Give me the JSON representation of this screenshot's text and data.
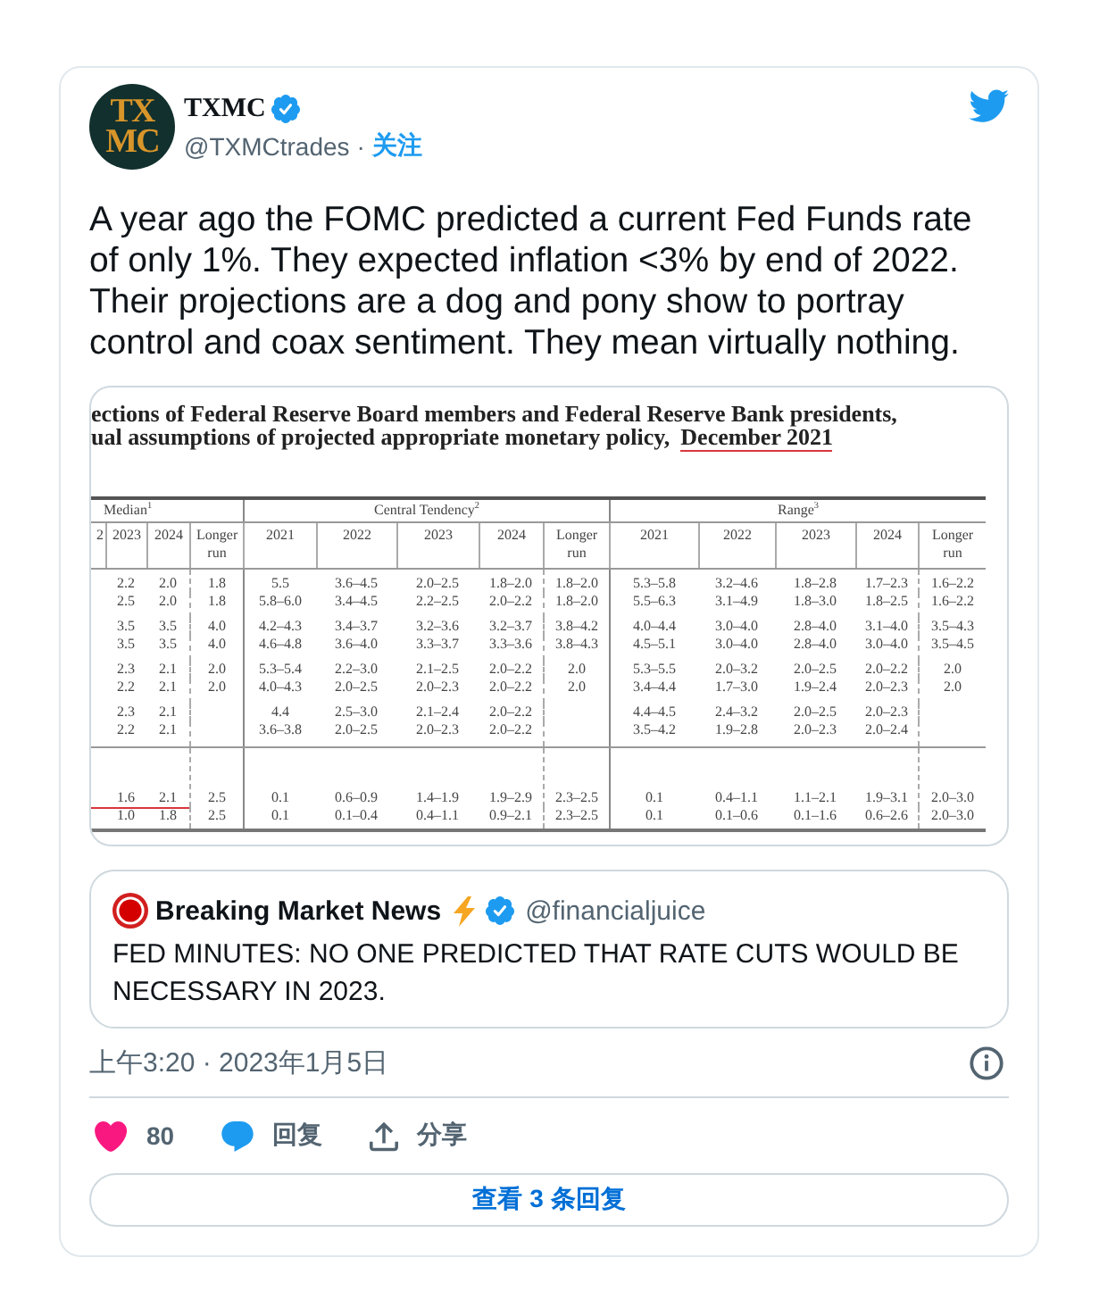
{
  "tweet": {
    "author": {
      "avatar_text": [
        "TX",
        "MC"
      ],
      "name": "TXMC",
      "verified": true,
      "handle": "@TXMCtrades",
      "separator": "·",
      "follow": "关注"
    },
    "text": "A year ago the FOMC predicted a current Fed Funds rate of only 1%. They expected inflation <3% by end of 2022. Their projections are a dog and pony show to portray control and coax sentiment. They mean virtually nothing.",
    "media": {
      "heading": [
        [
          {
            "text": "ections of Federal Reserve Board members and Federal Reserve Bank presidents,",
            "underlined": false
          }
        ],
        [
          {
            "text": "ual assumptions of projected appropriate monetary policy,",
            "underlined": false
          },
          {
            "text": "December 2021",
            "underlined": true
          }
        ]
      ],
      "table": {
        "groups": [
          {
            "label": "Median$^{1}$",
            "columns": [
              "2",
              "2023",
              "2024",
              "Longer run"
            ]
          },
          {
            "label": "Central Tendency$^{2}$",
            "columns": [
              "2021",
              "2022",
              "2023",
              "2024",
              "Longer run"
            ]
          },
          {
            "label": "Range$^{3}$",
            "columns": [
              "2021",
              "2022",
              "2023",
              "2024",
              "Longer run"
            ]
          }
        ],
        "sections": [
          {
            "row_groups": [
              {
                "rows": [
                  {
                    "cells": [
                      null,
                      "2.2",
                      "2.0",
                      "1.8",
                      "5.5",
                      "3.6–4.5",
                      "2.0–2.5",
                      "1.8–2.0",
                      "1.8–2.0",
                      "5.3–5.8",
                      "3.2–4.6",
                      "1.8–2.8",
                      "1.7–2.3",
                      "1.6–2.2"
                    ],
                    "underlined": false
                  },
                  {
                    "cells": [
                      null,
                      "2.5",
                      "2.0",
                      "1.8",
                      "5.8–6.0",
                      "3.4–4.5",
                      "2.2–2.5",
                      "2.0–2.2",
                      "1.8–2.0",
                      "5.5–6.3",
                      "3.1–4.9",
                      "1.8–3.0",
                      "1.8–2.5",
                      "1.6–2.2"
                    ],
                    "underlined": false
                  }
                ]
              },
              {
                "rows": [
                  {
                    "cells": [
                      null,
                      "3.5",
                      "3.5",
                      "4.0",
                      "4.2–4.3",
                      "3.4–3.7",
                      "3.2–3.6",
                      "3.2–3.7",
                      "3.8–4.2",
                      "4.0–4.4",
                      "3.0–4.0",
                      "2.8–4.0",
                      "3.1–4.0",
                      "3.5–4.3"
                    ],
                    "underlined": false
                  },
                  {
                    "cells": [
                      null,
                      "3.5",
                      "3.5",
                      "4.0",
                      "4.6–4.8",
                      "3.6–4.0",
                      "3.3–3.7",
                      "3.3–3.6",
                      "3.8–4.3",
                      "4.5–5.1",
                      "3.0–4.0",
                      "2.8–4.0",
                      "3.0–4.0",
                      "3.5–4.5"
                    ],
                    "underlined": false
                  }
                ]
              },
              {
                "rows": [
                  {
                    "cells": [
                      null,
                      "2.3",
                      "2.1",
                      "2.0",
                      "5.3–5.4",
                      "2.2–3.0",
                      "2.1–2.5",
                      "2.0–2.2",
                      "2.0",
                      "5.3–5.5",
                      "2.0–3.2",
                      "2.0–2.5",
                      "2.0–2.2",
                      "2.0"
                    ],
                    "underlined": false
                  },
                  {
                    "cells": [
                      null,
                      "2.2",
                      "2.1",
                      "2.0",
                      "4.0–4.3",
                      "2.0–2.5",
                      "2.0–2.3",
                      "2.0–2.2",
                      "2.0",
                      "3.4–4.4",
                      "1.7–3.0",
                      "1.9–2.4",
                      "2.0–2.3",
                      "2.0"
                    ],
                    "underlined": false
                  }
                ]
              },
              {
                "rows": [
                  {
                    "cells": [
                      null,
                      "2.3",
                      "2.1",
                      null,
                      "4.4",
                      "2.5–3.0",
                      "2.1–2.4",
                      "2.0–2.2",
                      null,
                      "4.4–4.5",
                      "2.4–3.2",
                      "2.0–2.5",
                      "2.0–2.3",
                      null
                    ],
                    "underlined": false
                  },
                  {
                    "cells": [
                      null,
                      "2.2",
                      "2.1",
                      null,
                      "3.6–3.8",
                      "2.0–2.5",
                      "2.0–2.3",
                      "2.0–2.2",
                      null,
                      "3.5–4.2",
                      "1.9–2.8",
                      "2.0–2.3",
                      "2.0–2.4",
                      null
                    ],
                    "underlined": false
                  }
                ]
              }
            ]
          },
          {
            "row_groups": [
              {
                "rows": [
                  {
                    "cells": [
                      null,
                      "1.6",
                      "2.1",
                      "2.5",
                      "0.1",
                      "0.6–0.9",
                      "1.4–1.9",
                      "1.9–2.9",
                      "2.3–2.5",
                      "0.1",
                      "0.4–1.1",
                      "1.1–2.1",
                      "1.9–3.1",
                      "2.0–3.0"
                    ],
                    "underlined": true
                  },
                  {
                    "cells": [
                      null,
                      "1.0",
                      "1.8",
                      "2.5",
                      "0.1",
                      "0.1–0.4",
                      "0.4–1.1",
                      "0.9–2.1",
                      "2.3–2.5",
                      "0.1",
                      "0.1–0.6",
                      "0.1–1.6",
                      "0.6–2.6",
                      "2.0–3.0"
                    ],
                    "underlined": false
                  }
                ]
              }
            ]
          }
        ]
      }
    },
    "quoted": {
      "name": "Breaking Market News",
      "verified": true,
      "handle": "@financialjuice",
      "text": "FED MINUTES: NO ONE PREDICTED THAT RATE CUTS WOULD BE NECESSARY IN 2023."
    },
    "timestamp": "上午3:20 · 2023年1月5日",
    "actions": [
      {
        "kind": "like",
        "label": "80"
      },
      {
        "kind": "reply",
        "label": "回复"
      },
      {
        "kind": "share",
        "label": "分享"
      }
    ],
    "replies_button": "查看 3 条回复"
  }
}
